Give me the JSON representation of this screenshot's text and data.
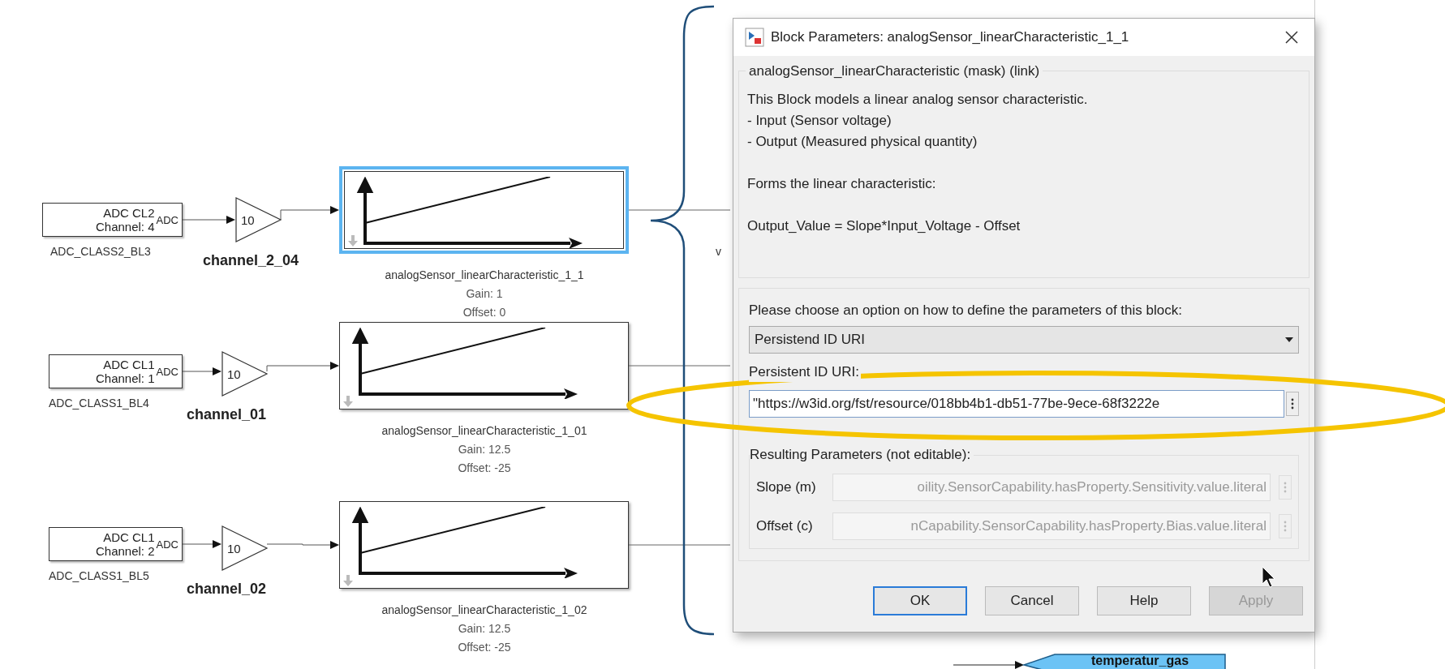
{
  "diagram": {
    "rows": [
      {
        "source": {
          "line1": "ADC CL2",
          "line2": "Channel: 4",
          "port": "ADC",
          "name": "ADC_CLASS2_BL3"
        },
        "gain": {
          "value": "10",
          "signal": "channel_2_04"
        },
        "characteristic": {
          "name": "analogSensor_linearCharacteristic_1_1",
          "gain": "Gain: 1",
          "offset": "Offset: 0",
          "selected": true
        }
      },
      {
        "source": {
          "line1": "ADC CL1",
          "line2": "Channel: 1",
          "port": "ADC",
          "name": "ADC_CLASS1_BL4"
        },
        "gain": {
          "value": "10",
          "signal": "channel_01"
        },
        "characteristic": {
          "name": "analogSensor_linearCharacteristic_1_01",
          "gain": "Gain: 12.5",
          "offset": "Offset: -25",
          "selected": false
        }
      },
      {
        "source": {
          "line1": "ADC CL1",
          "line2": "Channel: 2",
          "port": "ADC",
          "name": "ADC_CLASS1_BL5"
        },
        "gain": {
          "value": "10",
          "signal": "channel_02"
        },
        "characteristic": {
          "name": "analogSensor_linearCharacteristic_1_02",
          "gain": "Gain: 12.5",
          "offset": "Offset: -25",
          "selected": false
        }
      }
    ],
    "partial_label": "v",
    "goto_tag": "temperatur_gas"
  },
  "dialog": {
    "title": "Block Parameters: analogSensor_linearCharacteristic_1_1",
    "group_title": "analogSensor_linearCharacteristic (mask) (link)",
    "description": [
      [
        "This Block models a linear analog sensor characteristic.",
        "- Input (Sensor voltage)",
        "- Output (Measured physical quantity)"
      ],
      [
        "Forms the linear characteristic:"
      ],
      [
        "Output_Value = Slope*Input_Voltage - Offset"
      ]
    ],
    "prompt": "Please choose an option on how to define the parameters of this block:",
    "dropdown": {
      "value": "Persistend ID URI"
    },
    "uri": {
      "label": "Persistent ID URI:",
      "value": "\"https://w3id.org/fst/resource/018bb4b1-db51-77be-9ece-68f3222e"
    },
    "resulting": {
      "title": "Resulting Parameters (not editable):",
      "params": [
        {
          "label": "Slope (m)",
          "value": "oility.SensorCapability.hasProperty.Sensitivity.value.literal"
        },
        {
          "label": "Offset (c)",
          "value": "nCapability.SensorCapability.hasProperty.Bias.value.literal"
        }
      ]
    },
    "buttons": [
      {
        "label": "OK",
        "default": true,
        "disabled": false
      },
      {
        "label": "Cancel",
        "default": false,
        "disabled": false
      },
      {
        "label": "Help",
        "default": false,
        "disabled": false
      },
      {
        "label": "Apply",
        "default": false,
        "disabled": true
      }
    ]
  }
}
